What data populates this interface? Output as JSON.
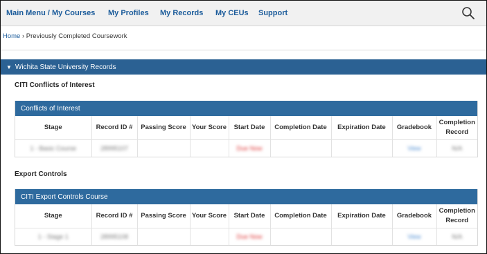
{
  "nav": {
    "items": [
      "Main Menu / My Courses",
      "My Profiles",
      "My Records",
      "My CEUs",
      "Support"
    ],
    "search_icon": "search-icon"
  },
  "breadcrumb": {
    "home": "Home",
    "separator": "›",
    "current": "Previously Completed Coursework"
  },
  "institution": {
    "title": "Wichita State University Records",
    "caret_icon": "caret-down-icon"
  },
  "sections": [
    {
      "title": "CITI Conflicts of Interest",
      "course": "Conflicts of Interest",
      "row": {
        "stage": "1 - Basic Course",
        "record_id": "28995107",
        "passing_score": "",
        "your_score": "",
        "start_date": "Due Now",
        "completion_date": "",
        "expiration_date": "",
        "gradebook": "View",
        "completion_record": "N/A"
      }
    },
    {
      "title": "Export Controls",
      "course": "CITI Export Controls Course",
      "row": {
        "stage": "1 - Stage 1",
        "record_id": "28995108",
        "passing_score": "",
        "your_score": "",
        "start_date": "Due Now",
        "completion_date": "",
        "expiration_date": "",
        "gradebook": "View",
        "completion_record": "N/A"
      }
    }
  ],
  "table_headers": {
    "stage": "Stage",
    "record_id": "Record ID #",
    "passing_score": "Passing Score",
    "your_score": "Your Score",
    "start_date": "Start Date",
    "completion_date": "Completion Date",
    "expiration_date": "Expiration Date",
    "gradebook": "Gradebook",
    "completion_record": "Completion Record"
  },
  "colors": {
    "nav_link": "#1c5c9b",
    "bar": "#2b6193",
    "due_text": "#d33333"
  }
}
